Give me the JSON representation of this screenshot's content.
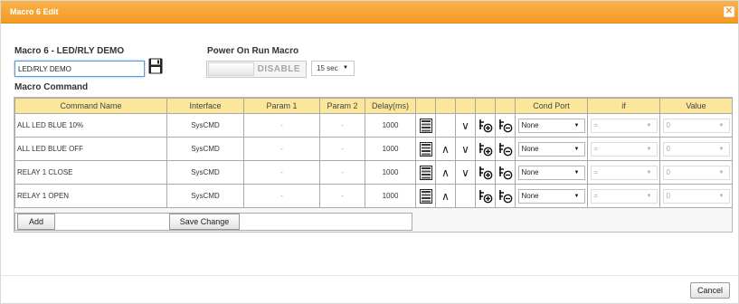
{
  "dialog": {
    "title": "Macro 6 Edit",
    "close_glyph": "✕"
  },
  "form": {
    "macro_label": "Macro 6 - LED/RLY DEMO",
    "macro_name_value": "LED/RLY DEMO",
    "power_on_label": "Power On Run Macro",
    "power_on_state": "DISABLE",
    "delay_select_value": "15 sec",
    "macro_command_label": "Macro Command"
  },
  "table": {
    "headers": {
      "command_name": "Command Name",
      "interface": "Interface",
      "param1": "Param 1",
      "param2": "Param 2",
      "delay": "Delay(ms)",
      "cond_port": "Cond Port",
      "if": "if",
      "value": "Value"
    },
    "rows": [
      {
        "name": "ALL LED BLUE 10%",
        "interface": "SysCMD",
        "param1": "-",
        "param2": "-",
        "delay": "1000",
        "cond": "None",
        "if": "=",
        "value": "0"
      },
      {
        "name": "ALL LED BLUE OFF",
        "interface": "SysCMD",
        "param1": "-",
        "param2": "-",
        "delay": "1000",
        "cond": "None",
        "if": "=",
        "value": "0"
      },
      {
        "name": "RELAY 1 CLOSE",
        "interface": "SysCMD",
        "param1": "-",
        "param2": "-",
        "delay": "1000",
        "cond": "None",
        "if": "=",
        "value": "0"
      },
      {
        "name": "RELAY 1 OPEN",
        "interface": "SysCMD",
        "param1": "-",
        "param2": "-",
        "delay": "1000",
        "cond": "None",
        "if": "=",
        "value": "0"
      }
    ]
  },
  "buttons": {
    "add": "Add",
    "save_change": "Save Change",
    "cancel": "Cancel"
  },
  "icons": {
    "up": "∧",
    "down": "∨",
    "dropdown": "▼"
  },
  "colors": {
    "titlebar": "#f39a23",
    "header_bg": "#fce699"
  }
}
